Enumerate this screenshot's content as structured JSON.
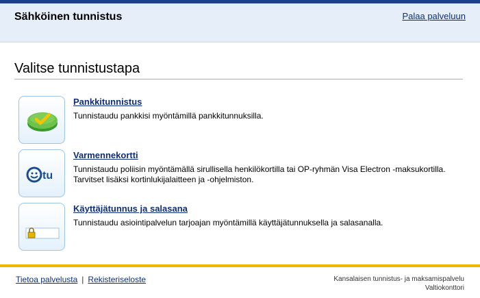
{
  "header": {
    "title": "Sähköinen tunnistus",
    "back_link": "Palaa palveluun"
  },
  "main": {
    "heading": "Valitse tunnistustapa",
    "methods": [
      {
        "title": "Pankkitunnistus",
        "description": "Tunnistaudu pankkisi myöntämillä pankkitunnuksilla.",
        "icon": "bank-check-icon"
      },
      {
        "title": "Varmennekortti",
        "description": "Tunnistaudu poliisin myöntämällä sirullisella henkilökortilla tai OP-ryhmän Visa Electron -maksukortilla. Tarvitset lisäksi kortinlukijalaitteen ja -ohjelmiston.",
        "icon": "tupas-card-icon",
        "logo_text": "tu"
      },
      {
        "title": "Käyttäjätunnus ja salasana",
        "description": "Tunnistaudu asiointipalvelun tarjoajan myöntämillä käyttäjätunnuksella ja salasanalla.",
        "icon": "padlock-password-icon"
      }
    ]
  },
  "footer": {
    "link_about": "Tietoa palvelusta",
    "separator": "|",
    "link_register": "Rekisteriseloste",
    "org_line1": "Kansalaisen tunnistus- ja maksamispalvelu",
    "org_line2": "Valtiokonttori"
  },
  "colors": {
    "header_bg": "#e5eef9",
    "top_bar": "#1f3f8f",
    "accent_gold": "#f2b600",
    "link": "#0e2e7c"
  }
}
